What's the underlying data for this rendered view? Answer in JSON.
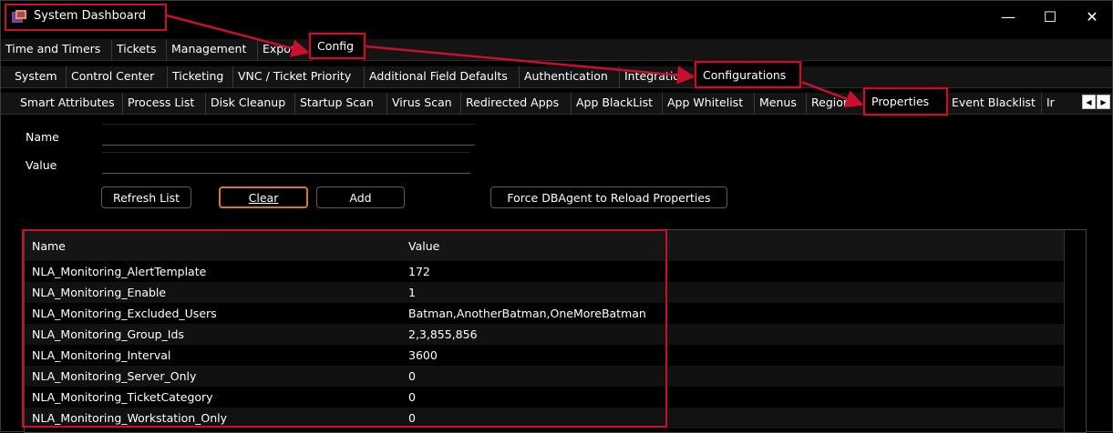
{
  "window": {
    "title": "System Dashboard",
    "controls": {
      "minimize": "—",
      "maximize": "☐",
      "close": "✕"
    }
  },
  "tabs_row1": [
    "Time and Timers",
    "Tickets",
    "Management",
    "Export",
    "Config"
  ],
  "tabs_row2": [
    "System",
    "Control Center",
    "Ticketing",
    "VNC / Ticket Priority",
    "Additional Field Defaults",
    "Authentication",
    "Integratio",
    "Configurations"
  ],
  "tabs_row3": [
    "Smart Attributes",
    "Process List",
    "Disk Cleanup",
    "Startup Scan",
    "Virus Scan",
    "Redirected Apps",
    "App BlackList",
    "App Whitelist",
    "Menus",
    "Regions",
    "Properties",
    "Event Blacklist",
    "Ir"
  ],
  "scroll_arrows": {
    "left": "◀",
    "right": "▶"
  },
  "form": {
    "name_label": "Name",
    "name_value": "",
    "value_label": "Value",
    "value_value": "",
    "refresh_label": "Refresh List",
    "clear_label": "Clear",
    "add_label": "Add",
    "force_label": "Force DBAgent to Reload Properties"
  },
  "list": {
    "columns": [
      "Name",
      "Value"
    ],
    "rows": [
      [
        "NLA_Monitoring_AlertTemplate",
        "172"
      ],
      [
        "NLA_Monitoring_Enable",
        "1"
      ],
      [
        "NLA_Monitoring_Excluded_Users",
        "Batman,AnotherBatman,OneMoreBatman"
      ],
      [
        "NLA_Monitoring_Group_Ids",
        "2,3,855,856"
      ],
      [
        "NLA_Monitoring_Interval",
        "3600"
      ],
      [
        "NLA_Monitoring_Server_Only",
        "0"
      ],
      [
        "NLA_Monitoring_TicketCategory",
        "0"
      ],
      [
        "NLA_Monitoring_Workstation_Only",
        "0"
      ]
    ]
  },
  "colors": {
    "annotation": "#c8102e",
    "focus": "#d87b1a",
    "background": "#000000"
  }
}
